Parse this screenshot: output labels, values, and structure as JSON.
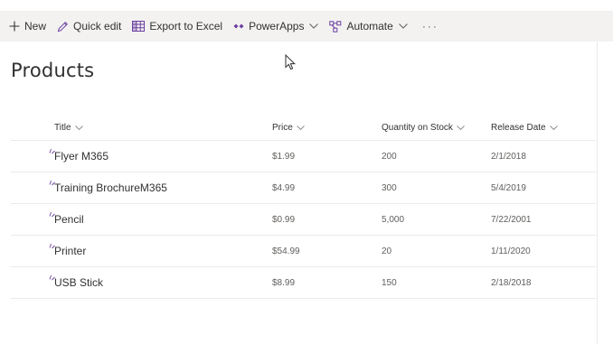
{
  "command_bar": {
    "new_label": "New",
    "quick_edit_label": "Quick edit",
    "export_label": "Export to Excel",
    "powerapps_label": "PowerApps",
    "automate_label": "Automate",
    "more_label": "···"
  },
  "page": {
    "title": "Products"
  },
  "columns": {
    "title": "Title",
    "price": "Price",
    "quantity": "Quantity on Stock",
    "release_date": "Release Date"
  },
  "rows": [
    {
      "title": "Flyer M365",
      "price": "$1.99",
      "quantity": "200",
      "release_date": "2/1/2018"
    },
    {
      "title": "Training BrochureM365",
      "price": "$4.99",
      "quantity": "300",
      "release_date": "5/4/2019"
    },
    {
      "title": "Pencil",
      "price": "$0.99",
      "quantity": "5,000",
      "release_date": "7/22/2001"
    },
    {
      "title": "Printer",
      "price": "$54.99",
      "quantity": "20",
      "release_date": "1/11/2020"
    },
    {
      "title": "USB Stick",
      "price": "$8.99",
      "quantity": "150",
      "release_date": "2/18/2018"
    }
  ],
  "icons": {
    "new": "plus-icon",
    "quick_edit": "pencil-icon",
    "export": "excel-grid-icon",
    "powerapps": "powerapps-icon",
    "automate": "flow-icon",
    "new_item": "new-item-sparkle-icon"
  },
  "colors": {
    "command_bar_bg": "#f3f2f1",
    "accent": "#6b3fa0",
    "text": "#323130",
    "muted": "#605e5c"
  }
}
